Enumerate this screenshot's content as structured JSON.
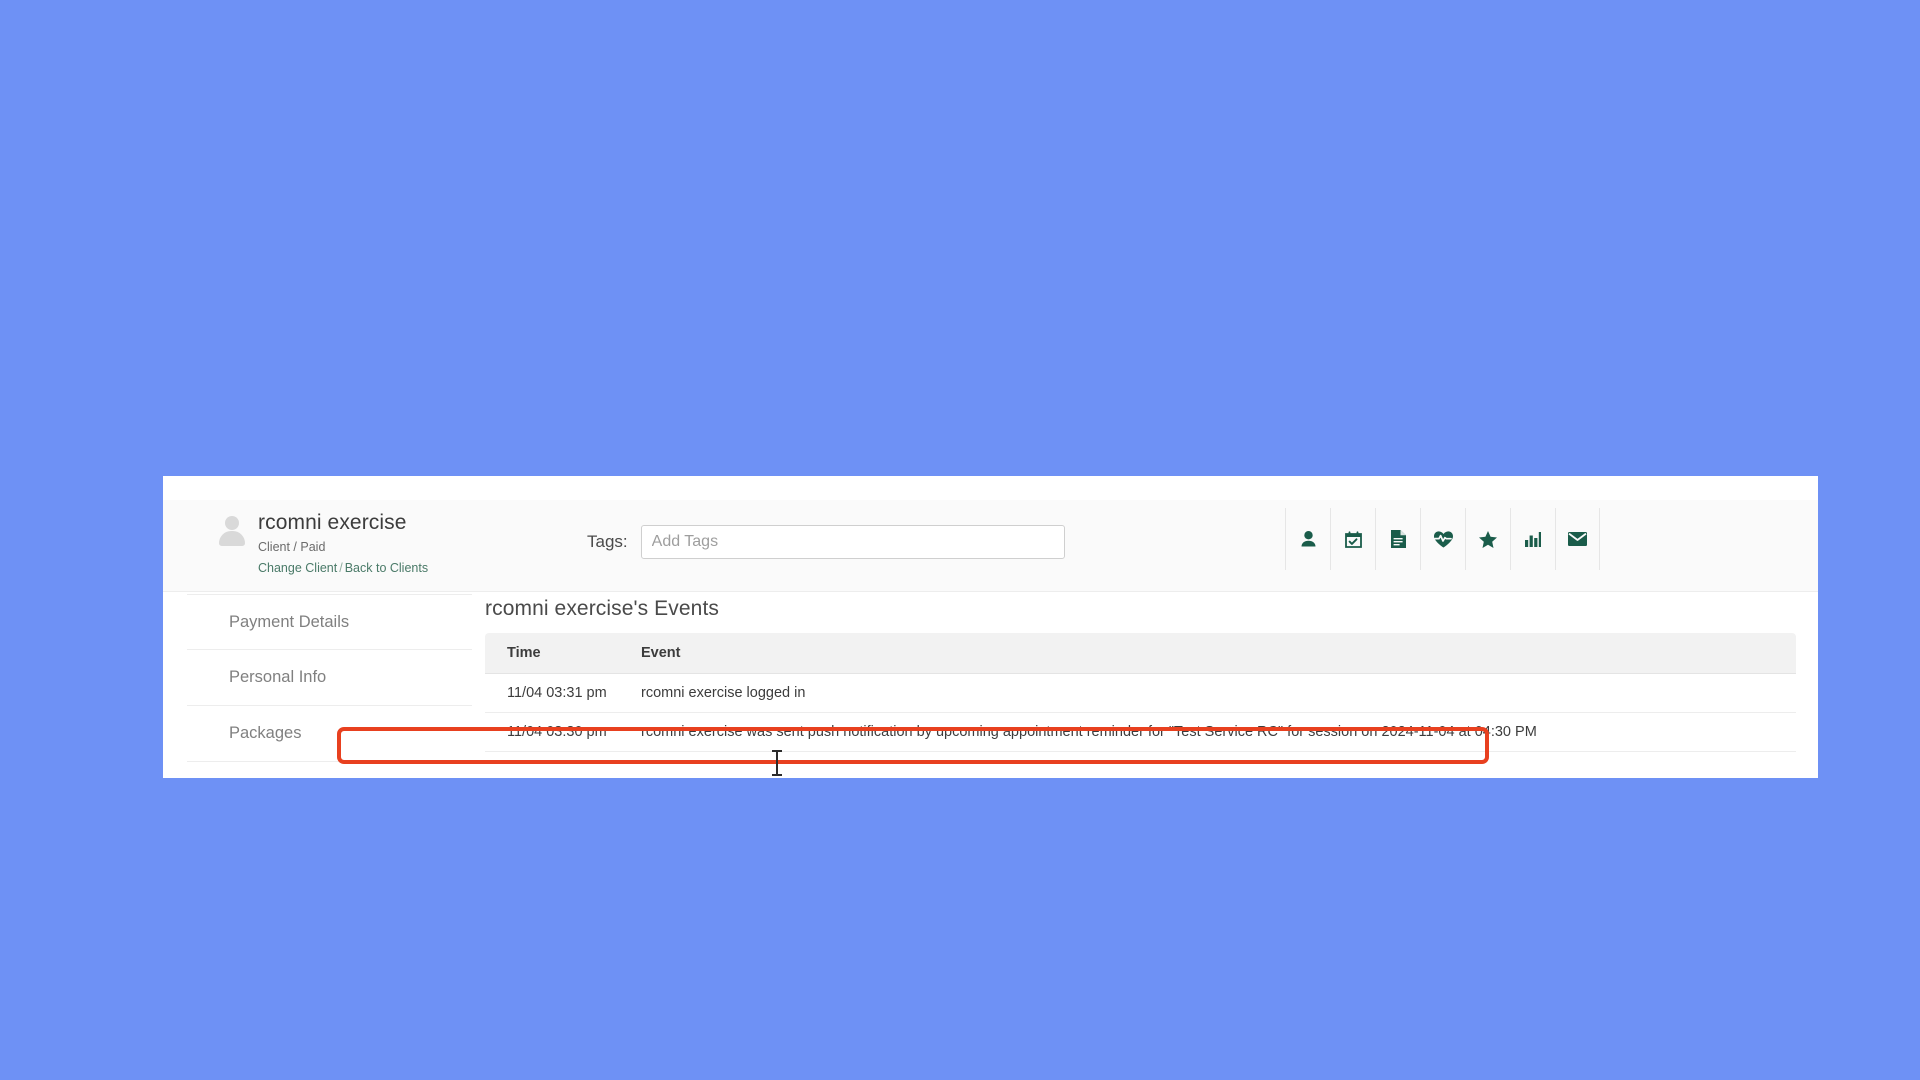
{
  "background_color": "#6e91f5",
  "accent_color": "#1a5c4a",
  "highlight_color": "#e8401f",
  "client": {
    "avatar_icon": "user-placeholder-avatar-icon",
    "name": "rcomni exercise",
    "subtitle": "Client / Paid",
    "change_client_label": "Change Client",
    "links_separator": "/",
    "back_to_clients_label": "Back to Clients"
  },
  "tags": {
    "label": "Tags:",
    "value": "",
    "placeholder": "Add Tags"
  },
  "icon_bar": [
    {
      "name": "person-icon"
    },
    {
      "name": "calendar-check-icon"
    },
    {
      "name": "document-icon"
    },
    {
      "name": "heartbeat-icon"
    },
    {
      "name": "star-icon"
    },
    {
      "name": "bar-chart-icon"
    },
    {
      "name": "envelope-icon"
    }
  ],
  "sidebar": {
    "items": [
      {
        "label": "Payment Details"
      },
      {
        "label": "Personal Info"
      },
      {
        "label": "Packages"
      }
    ]
  },
  "main": {
    "events_title": "rcomni exercise's Events",
    "table": {
      "columns": [
        "Time",
        "Event"
      ],
      "rows": [
        {
          "time": "11/04 03:31 pm",
          "event": "rcomni exercise logged in"
        },
        {
          "time": "11/04 03:30 pm",
          "event": "rcomni exercise was sent push notification by upcoming appointment reminder for \"Test Service RC\" for session on 2024-11-04 at 04:30 PM"
        }
      ]
    }
  }
}
